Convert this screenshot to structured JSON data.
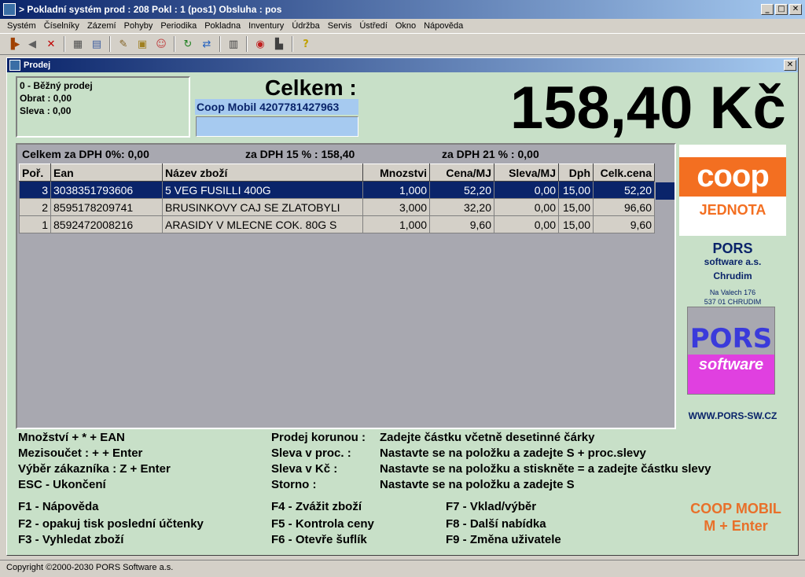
{
  "window": {
    "title": "> Pokladní systém prod : 208 Pokl : 1 (pos1) Obsluha : pos"
  },
  "menu": [
    "Systém",
    "Číselníky",
    "Zázemí",
    "Pohyby",
    "Periodika",
    "Pokladna",
    "Inventury",
    "Údržba",
    "Servis",
    "Ústředí",
    "Okno",
    "Nápověda"
  ],
  "toolbar_icons": [
    "door-exit-icon",
    "arrow-left-icon",
    "delete-icon",
    "calculator-icon",
    "document-icon",
    "tools-icon",
    "package-icon",
    "users-icon",
    "refresh-icon",
    "user-switch-icon",
    "calendar-icon",
    "info-icon",
    "chart-icon",
    "help-icon"
  ],
  "child": {
    "title": "Prodej",
    "info": {
      "line1": "0 - Běžný prodej",
      "line2": "Obrat : 0,00",
      "line3": "Sleva : 0,00"
    },
    "celkem_label": "Celkem :",
    "coop_mobil": "Coop Mobil 4207781427963",
    "total": "158,40 Kč",
    "vat": {
      "dph0": "Celkem za DPH 0%: 0,00",
      "dph15": "za DPH 15 % : 158,40",
      "dph21": "za DPH 21 % : 0,00"
    },
    "table": {
      "headers": [
        "Poř.",
        "Ean",
        "Název zboží",
        "Mnozstvi",
        "Cena/MJ",
        "Sleva/MJ",
        "Dph",
        "Celk.cena"
      ],
      "rows": [
        [
          "3",
          "3038351793606",
          "5 VEG FUSILLI 400G",
          "1,000",
          "52,20",
          "0,00",
          "15,00",
          "52,20"
        ],
        [
          "2",
          "8595178209741",
          " BRUSINKOVY CAJ SE ZLATOBYLI",
          "3,000",
          "32,20",
          "0,00",
          "15,00",
          "96,60"
        ],
        [
          "1",
          "8592472008216",
          "ARASIDY V MLECNE COK. 80G S",
          "1,000",
          "9,60",
          "0,00",
          "15,00",
          "9,60"
        ]
      ]
    },
    "side": {
      "coop_top": "coop",
      "coop_bottom": "JEDNOTA",
      "pors_name": "PORS",
      "pors_sub": "software a.s.",
      "pors_city": "Chrudim",
      "addr1": "Na Valech 176",
      "addr2": "537 01 CHRUDIM",
      "logo_top": "PORS",
      "logo_bottom": "software",
      "www": "WWW.PORS-SW.CZ"
    },
    "help": {
      "c1": [
        "Množství +  *   + EAN",
        "Mezisoučet :  +   + Enter",
        "Výběr zákazníka : Z + Enter",
        "ESC - Ukončení"
      ],
      "c2": [
        "Prodej korunou :",
        "Sleva v proc. :",
        "Sleva v Kč :",
        "Storno :"
      ],
      "c3": [
        "Zadejte částku včetně desetinné čárky",
        "Nastavte se na položku a zadejte S + proc.slevy",
        "Nastavte se na položku a stiskněte  =  a zadejte částku slevy",
        "Nastavte se na položku a zadejte S"
      ],
      "f1": [
        "F1 - Nápověda",
        "F2 - opakuj tisk poslední účtenky",
        "F3 - Vyhledat zboží"
      ],
      "f2": [
        "F4 - Zvážit zboží",
        "F5 - Kontrola ceny",
        "F6 - Otevře šuflík"
      ],
      "f3": [
        "F7 - Vklad/výběr",
        "F8 - Další nabídka",
        "F9 - Změna uživatele"
      ],
      "coop_mobil_line1": "COOP MOBIL",
      "coop_mobil_line2": "M + Enter"
    }
  },
  "status": "Copyright ©2000-2030 PORS Software a.s."
}
